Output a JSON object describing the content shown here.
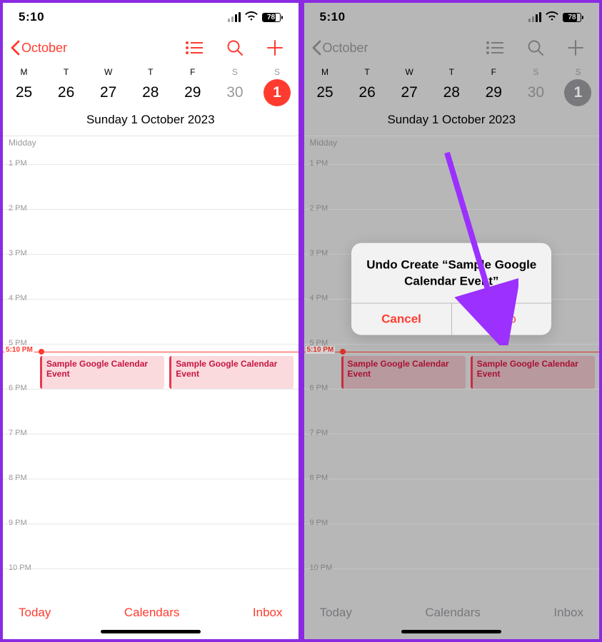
{
  "status": {
    "time": "5:10",
    "battery": "78"
  },
  "nav": {
    "back": "October"
  },
  "week": {
    "days": [
      "M",
      "T",
      "W",
      "T",
      "F",
      "S",
      "S"
    ],
    "dates": [
      "25",
      "26",
      "27",
      "28",
      "29",
      "30",
      "1"
    ]
  },
  "dateTitle": "Sunday  1 October 2023",
  "hours": {
    "midday": "Midday",
    "labels": [
      "1 PM",
      "2 PM",
      "3 PM",
      "4 PM",
      "5 PM",
      "6 PM",
      "7 PM",
      "8 PM",
      "9 PM",
      "10 PM"
    ],
    "nowLabel": "5:10 PM"
  },
  "events": [
    {
      "title": "Sample Google Calendar Event"
    },
    {
      "title": "Sample Google Calendar Event"
    }
  ],
  "footer": {
    "today": "Today",
    "calendars": "Calendars",
    "inbox": "Inbox"
  },
  "alert": {
    "title": "Undo Create “Sample Google Calendar Event”",
    "cancel": "Cancel",
    "undo": "Undo"
  }
}
